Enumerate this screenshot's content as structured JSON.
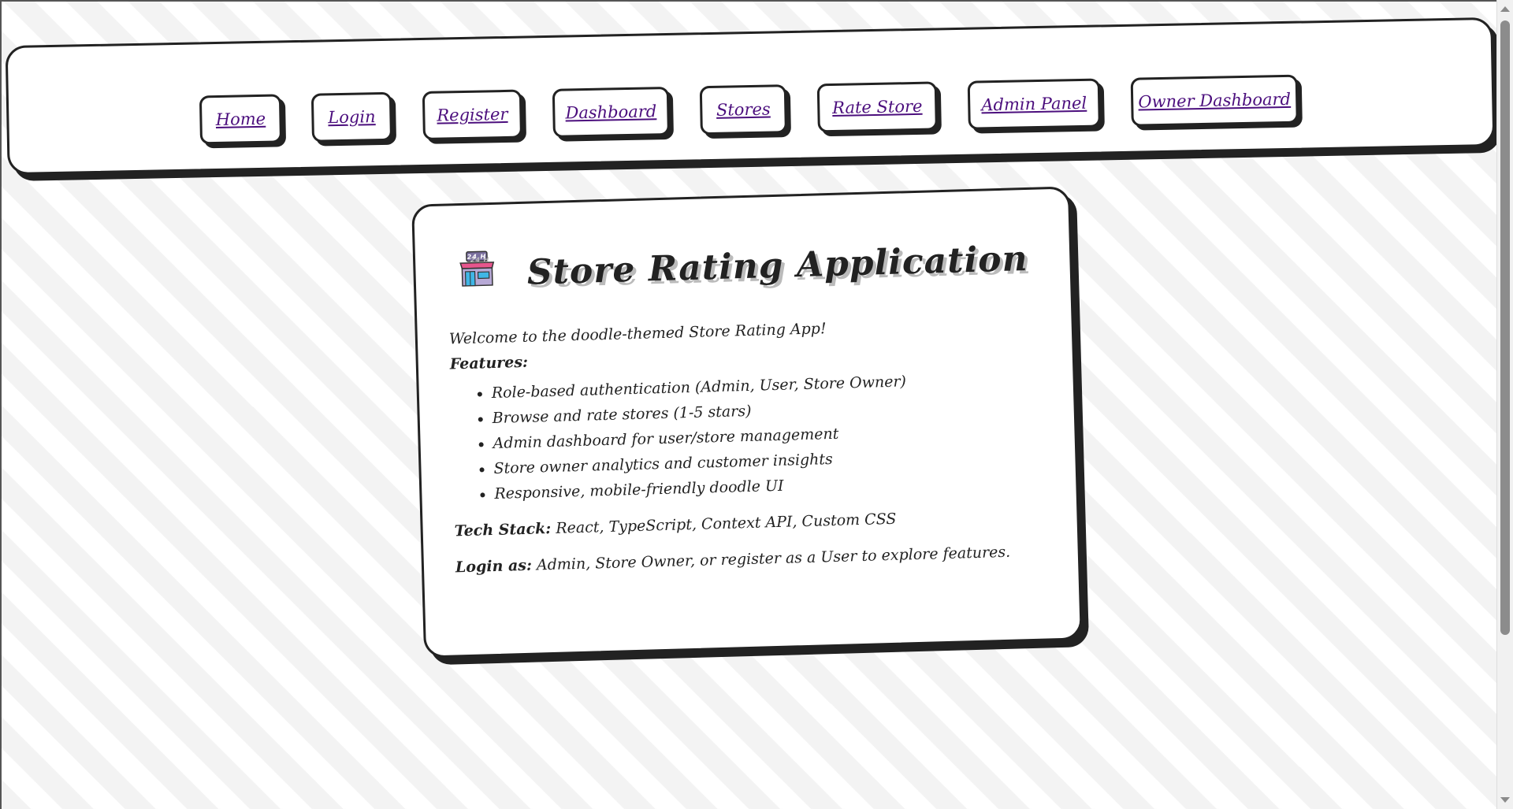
{
  "nav": {
    "links": [
      {
        "label": "Home"
      },
      {
        "label": "Login"
      },
      {
        "label": "Register"
      },
      {
        "label": "Dashboard"
      },
      {
        "label": "Stores"
      },
      {
        "label": "Rate Store"
      },
      {
        "label": "Admin Panel"
      },
      {
        "label": "Owner Dashboard"
      }
    ],
    "link_color": "#4b0e7d"
  },
  "card": {
    "icon": "store-24h-icon",
    "title": "Store Rating Application",
    "welcome": "Welcome to the doodle-themed Store Rating App!",
    "features_label": "Features:",
    "features": [
      "Role-based authentication (Admin, User, Store Owner)",
      "Browse and rate stores (1-5 stars)",
      "Admin dashboard for user/store management",
      "Store owner analytics and customer insights",
      "Responsive, mobile-friendly doodle UI"
    ],
    "tech_label": "Tech Stack:",
    "tech_value": "React, TypeScript, Context API, Custom CSS",
    "login_label": "Login as:",
    "login_value": "Admin, Store Owner, or register as a User to explore features."
  },
  "icon_badge": "24 H"
}
